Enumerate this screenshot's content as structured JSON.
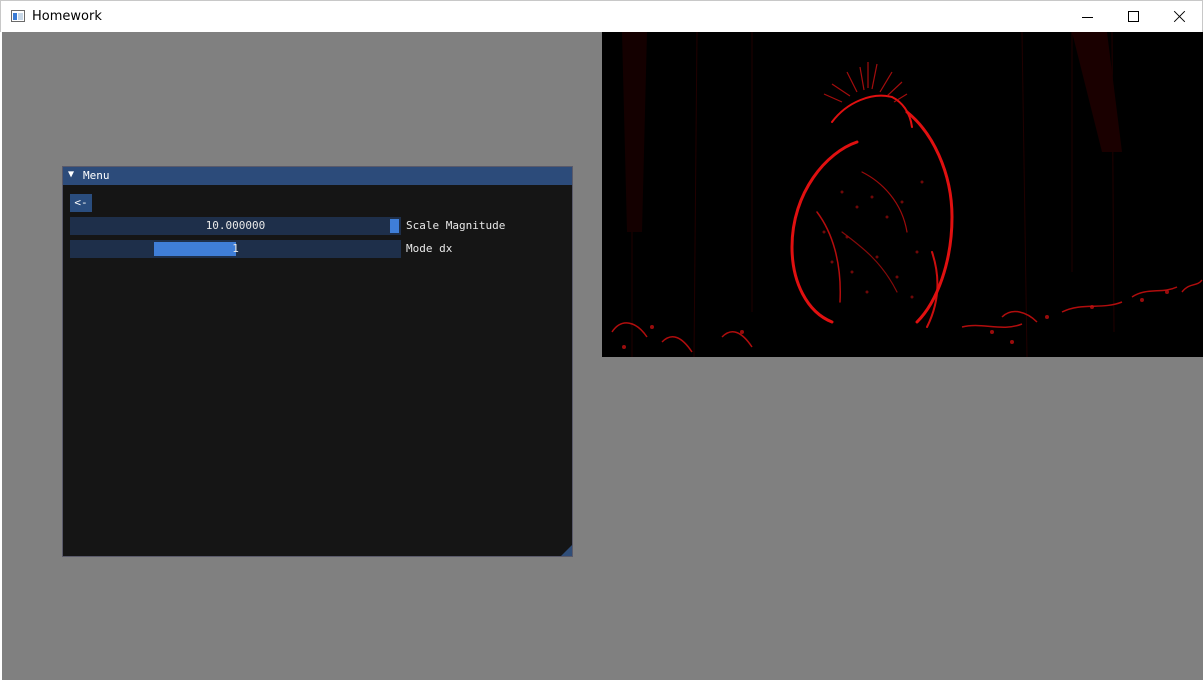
{
  "window": {
    "title": "Homework",
    "controls": [
      "minimize",
      "maximize",
      "close"
    ]
  },
  "menu": {
    "title": "Menu",
    "collapse_icon": "▼",
    "back_button_label": "<-",
    "sliders": [
      {
        "label": "Scale Magnitude",
        "value_text": "10.000000"
      },
      {
        "label": "Mode dx",
        "value_text": "1"
      }
    ]
  },
  "image": {
    "description_icon": "edge-detection-image",
    "edge_color": "#e01010",
    "background_color": "#000000"
  },
  "colors": {
    "client_background": "#808080",
    "menu_background": "#151515",
    "menu_header": "#2c4b7a",
    "slider_track": "#1e2f4a",
    "slider_grab": "#3f7ed8"
  }
}
